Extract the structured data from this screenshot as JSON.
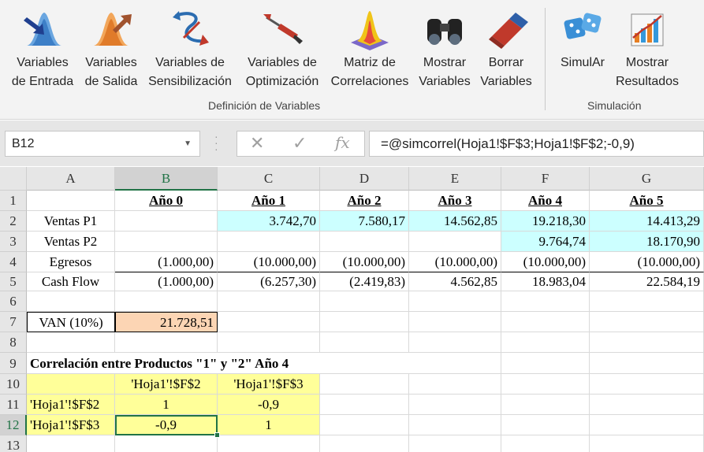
{
  "ribbon": {
    "buttons": [
      {
        "id": "variables-de-entrada",
        "line1": "Variables",
        "line2": "de Entrada",
        "icon": "input-variable-icon"
      },
      {
        "id": "variables-de-salida",
        "line1": "Variables",
        "line2": "de Salida",
        "icon": "output-variable-icon"
      },
      {
        "id": "variables-de-sensibilizacion",
        "line1": "Variables de",
        "line2": "Sensibilización",
        "icon": "sensitivity-icon"
      },
      {
        "id": "variables-de-optimizacion",
        "line1": "Variables de",
        "line2": "Optimización",
        "icon": "dart-icon"
      },
      {
        "id": "matriz-de-correlaciones",
        "line1": "Matriz de",
        "line2": "Correlaciones",
        "icon": "correlation-surface-icon"
      },
      {
        "id": "mostrar-variables",
        "line1": "Mostrar",
        "line2": "Variables",
        "icon": "binoculars-icon"
      },
      {
        "id": "borrar-variables",
        "line1": "Borrar",
        "line2": "Variables",
        "icon": "eraser-icon"
      },
      {
        "id": "simular",
        "line1": "SimulAr",
        "line2": "",
        "icon": "dice-icon"
      },
      {
        "id": "mostrar-resultados",
        "line1": "Mostrar",
        "line2": "Resultados",
        "icon": "results-chart-icon"
      }
    ],
    "groups": {
      "definicion": "Definición de Variables",
      "simulacion": "Simulación"
    }
  },
  "formula_bar": {
    "name_box": "B12",
    "formula": "=@simcorrel(Hoja1!$F$3;Hoja1!$F$2;-0,9)",
    "cancel_glyph": "✕",
    "enter_glyph": "✓",
    "fx_glyph": "fx"
  },
  "sheet": {
    "columns": [
      "A",
      "B",
      "C",
      "D",
      "E",
      "F",
      "G"
    ],
    "rows": [
      "1",
      "2",
      "3",
      "4",
      "5",
      "6",
      "7",
      "8",
      "9",
      "10",
      "11",
      "12",
      "13"
    ],
    "cells": {
      "B1": "Año 0",
      "C1": "Año 1",
      "D1": "Año 2",
      "E1": "Año 3",
      "F1": "Año 4",
      "G1": "Año 5",
      "A2": "Ventas P1",
      "C2": "3.742,70",
      "D2": "7.580,17",
      "E2": "14.562,85",
      "F2": "19.218,30",
      "G2": "14.413,29",
      "A3": "Ventas P2",
      "F3": "9.764,74",
      "G3": "18.170,90",
      "A4": "Egresos",
      "B4": "(1.000,00)",
      "C4": "(10.000,00)",
      "D4": "(10.000,00)",
      "E4": "(10.000,00)",
      "F4": "(10.000,00)",
      "G4": "(10.000,00)",
      "A5": "Cash Flow",
      "B5": "(1.000,00)",
      "C5": "(6.257,30)",
      "D5": "(2.419,83)",
      "E5": "4.562,85",
      "F5": "18.983,04",
      "G5": "22.584,19",
      "A7": "VAN (10%)",
      "B7": "21.728,51",
      "A9": "Correlación entre Productos \"1\" y \"2\" Año 4",
      "B10": "'Hoja1'!$F$2",
      "C10": "'Hoja1'!$F$3",
      "A11": "'Hoja1'!$F$2",
      "B11": "1",
      "C11": "-0,9",
      "A12": "'Hoja1'!$F$3",
      "B12": "-0,9",
      "C12": "1"
    },
    "colors": {
      "cyan": "#ccffff",
      "orange": "#fcd5b4",
      "yellow": "#ffff99",
      "selection": "#217346"
    },
    "selected_cell": "B12"
  }
}
